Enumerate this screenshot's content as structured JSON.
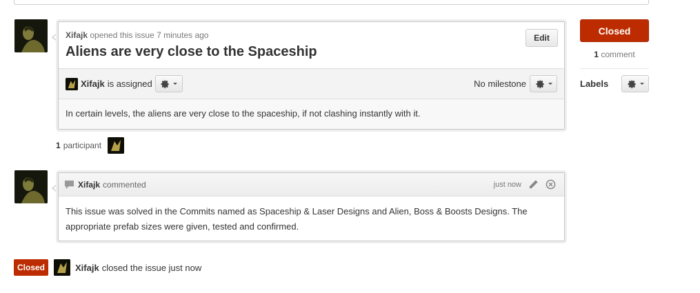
{
  "issue": {
    "author": "Xifajk",
    "opened_text": "opened this issue 7 minutes ago",
    "title": "Aliens are very close to the Spaceship",
    "edit_label": "Edit",
    "assignee": "Xifajk",
    "assigned_text": "is assigned",
    "milestone_text": "No milestone",
    "body": "In certain levels, the aliens are very close to the spaceship, if not clashing instantly with it."
  },
  "participants": {
    "count": "1",
    "label": "participant"
  },
  "comment": {
    "author": "Xifajk",
    "action": "commented",
    "time": "just now",
    "body": "This issue was solved in the Commits named as Spaceship & Laser Designs and Alien, Boss & Boosts Designs. The appropriate prefab sizes were given, tested and confirmed."
  },
  "sidebar": {
    "state_label": "Closed",
    "comment_count": "1",
    "comment_label": "comment",
    "labels_heading": "Labels"
  },
  "event": {
    "badge": "Closed",
    "actor": "Xifajk",
    "text": "closed the issue just now"
  },
  "colors": {
    "closed_red": "#bd2c00"
  },
  "icons": [
    "gear-icon",
    "caret-down-icon",
    "comment-icon",
    "pencil-icon",
    "delete-icon"
  ]
}
